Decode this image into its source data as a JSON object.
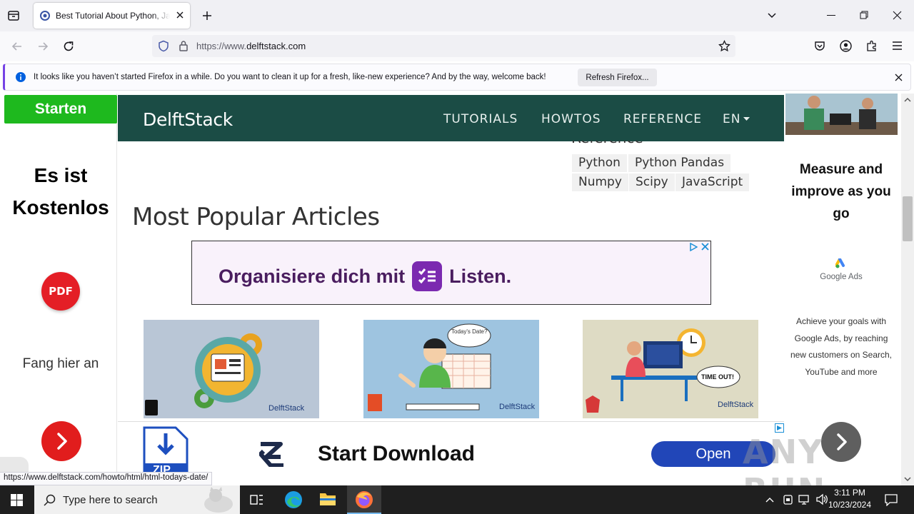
{
  "browser": {
    "tab_title": "Best Tutorial About Python, JavaScript",
    "url_prefix": "https://www.",
    "url_domain": "delftstack.com",
    "notification": "It looks like you haven’t started Firefox in a while. Do you want to clean it up for a fresh, like-new experience? And by the way, welcome back!",
    "notification_button": "Refresh Firefox...",
    "status_url": "https://www.delftstack.com/howto/html/html-todays-date/"
  },
  "left_ad": {
    "button": "Starten",
    "headline": "Es ist Kostenlos",
    "pdf_label": "PDF",
    "subline": "Fang hier an"
  },
  "site": {
    "brand": "DelftStack",
    "nav": [
      "TUTORIALS",
      "HOWTOS",
      "REFERENCE",
      "EN"
    ],
    "reference_heading": "Reference",
    "tags": [
      "Python",
      "Python Pandas",
      "Numpy",
      "Scipy",
      "JavaScript"
    ],
    "popular_heading": "Most Popular Articles",
    "thumb_brand": "DelftStack",
    "thumb_bubble_1": "Today's Date?",
    "thumb_bubble_3": "TIME OUT!"
  },
  "mid_ad": {
    "text_before": "Organisiere dich mit",
    "text_after": "Listen."
  },
  "right_ad": {
    "headline": "Measure and improve as you go",
    "brand": "Google Ads",
    "body": "Achieve your goals with Google Ads, by reaching new customers on Search, YouTube and more"
  },
  "bottom_ad": {
    "file_label": "ZIP",
    "headline": "Start Download",
    "button": "Open"
  },
  "taskbar": {
    "search_placeholder": "Type here to search",
    "time": "3:11 PM",
    "date": "10/23/2024"
  },
  "watermark": "ANY RUN"
}
